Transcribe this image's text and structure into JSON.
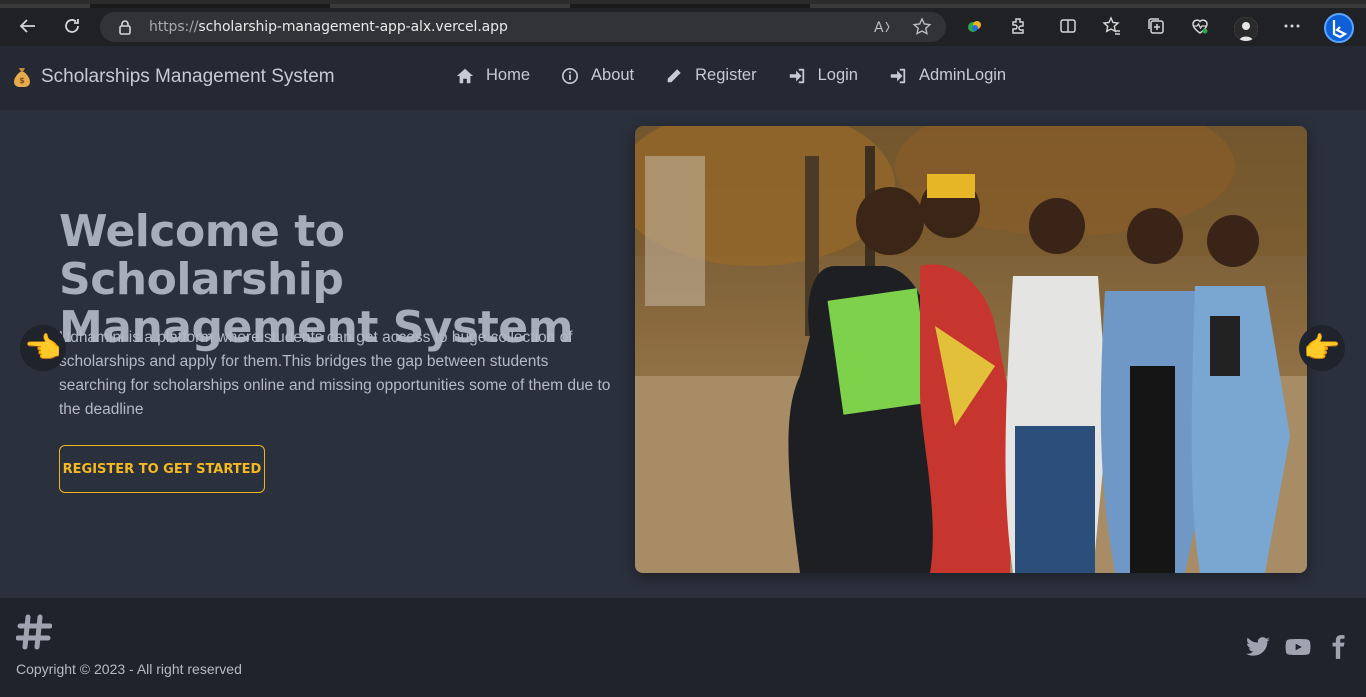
{
  "browser": {
    "url_scheme": "https://",
    "url_host": "scholarship-management-app-alx.vercel.app"
  },
  "header": {
    "brand": "Scholarships Management System",
    "nav": [
      {
        "label": "Home",
        "icon": "home-icon"
      },
      {
        "label": "About",
        "icon": "info-icon"
      },
      {
        "label": "Register",
        "icon": "pencil-icon"
      },
      {
        "label": "Login",
        "icon": "sign-in-icon"
      },
      {
        "label": "AdminLogin",
        "icon": "sign-in-icon"
      }
    ]
  },
  "hero": {
    "title": "Welcome to Scholarship Management System",
    "description": "Udhamini is a platform where students can get access to huge collection of scholarships and apply for them.This bridges the gap between students searching for scholarships online and missing opportunities some of them due to the deadline",
    "cta": "REGISTER TO GET STARTED",
    "prev_arrow": "👈",
    "next_arrow": "👉"
  },
  "footer": {
    "copyright": "Copyright © 2023 - All right reserved"
  },
  "colors": {
    "accent": "#f5b922",
    "background": "#2a303c",
    "header": "#242933",
    "footer": "#1f232b"
  }
}
